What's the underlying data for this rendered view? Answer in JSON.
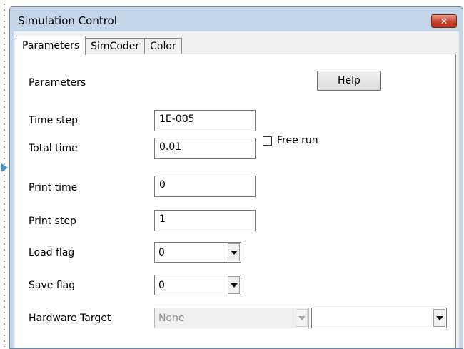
{
  "window": {
    "title": "Simulation Control",
    "close_glyph": "✕"
  },
  "tabs": [
    {
      "label": "Parameters",
      "active": true
    },
    {
      "label": "SimCoder",
      "active": false
    },
    {
      "label": "Color",
      "active": false
    }
  ],
  "panel": {
    "section_label": "Parameters",
    "help_label": "Help",
    "fields": {
      "time_step": {
        "label": "Time step",
        "value": "1E-005"
      },
      "total_time": {
        "label": "Total time",
        "value": "0.01"
      },
      "free_run": {
        "label": "Free run",
        "checked": false
      },
      "print_time": {
        "label": "Print time",
        "value": "0"
      },
      "print_step": {
        "label": "Print step",
        "value": "1"
      },
      "load_flag": {
        "label": "Load flag",
        "value": "0"
      },
      "save_flag": {
        "label": "Save flag",
        "value": "0"
      },
      "hardware_target": {
        "label": "Hardware Target",
        "value": "None",
        "secondary_value": ""
      }
    }
  },
  "colors": {
    "titlebar": "#c4d6ea",
    "close_button": "#c7452c",
    "panel": "#ffffff"
  }
}
